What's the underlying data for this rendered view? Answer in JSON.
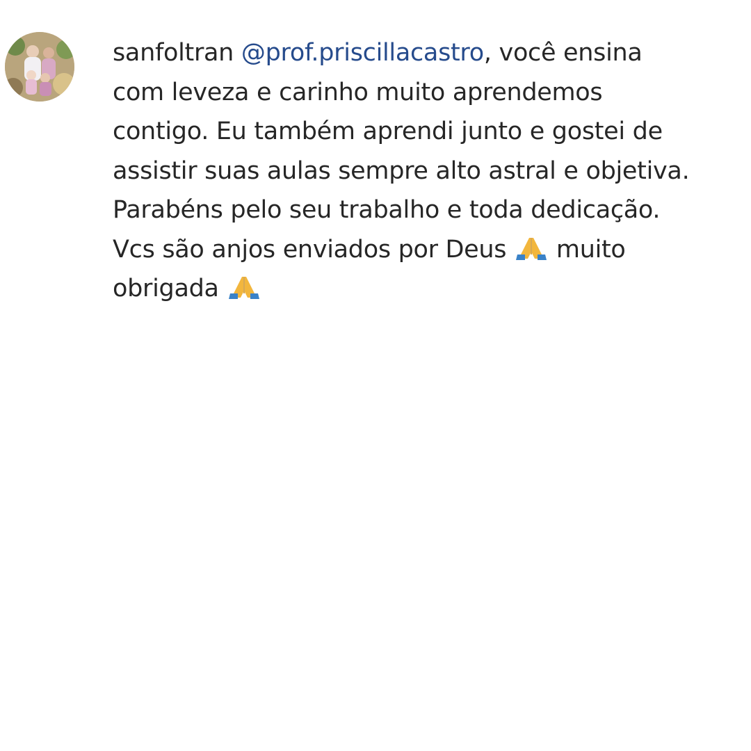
{
  "comment": {
    "username": "sanfoltran",
    "mention": "@prof.priscillacastro",
    "line1_rest": ", você ensina",
    "line2": "com leveza e carinho muito aprendemos",
    "line3": "contigo. Eu também aprendi junto e gostei de",
    "line4": "assistir suas aulas sempre alto astral e objetiva.",
    "line5": "Parabéns pelo seu trabalho e toda dedicação.",
    "line6_a": "Vcs são anjos enviados por Deus",
    "line6_b": "muito",
    "line7": "obrigada",
    "emoji_name": "folded-hands"
  },
  "colors": {
    "text": "#262626",
    "mention": "#264b8c",
    "background": "#ffffff"
  }
}
